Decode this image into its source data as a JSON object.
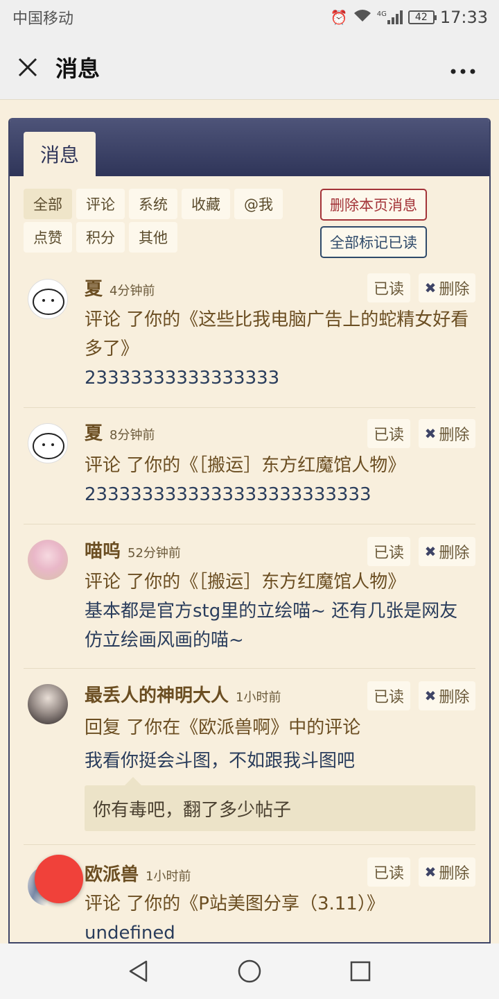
{
  "status": {
    "carrier": "中国移动",
    "battery": "42",
    "time": "17:33",
    "signal_label": "4G"
  },
  "header": {
    "title": "消息"
  },
  "panel": {
    "tab_label": "消息"
  },
  "filters": [
    "全部",
    "评论",
    "系统",
    "收藏",
    "@我",
    "点赞",
    "积分",
    "其他"
  ],
  "actions": {
    "delete_page": "删除本页消息",
    "mark_all_read": "全部标记已读"
  },
  "labels": {
    "read": "已读",
    "delete": "删除"
  },
  "messages": [
    {
      "user": "夏",
      "time": "4分钟前",
      "action": "评论 了你的《这些比我电脑广告上的蛇精女好看多了》",
      "content": "23333333333333333"
    },
    {
      "user": "夏",
      "time": "8分钟前",
      "action": "评论 了你的《［搬运］东方红魔馆人物》",
      "content": "2333333333333333333333333"
    },
    {
      "user": "喵呜",
      "time": "52分钟前",
      "action": "评论 了你的《［搬运］东方红魔馆人物》",
      "content": "基本都是官方stg里的立绘喵~ 还有几张是网友仿立绘画风画的喵~"
    },
    {
      "user": "最丢人的神明大人",
      "time": "1小时前",
      "action": "回复 了你在《欧派兽啊》中的评论",
      "content": "我看你挺会斗图，不如跟我斗图吧",
      "quote": "你有毒吧，翻了多少帖子"
    },
    {
      "user": "欧派兽",
      "time": "1小时前",
      "action": "评论 了你的《P站美图分享（3.11）》",
      "content": "undefined"
    }
  ],
  "colors": {
    "panel_header": "#3e4466",
    "background": "#f8efdd",
    "fab": "#f0413a"
  }
}
